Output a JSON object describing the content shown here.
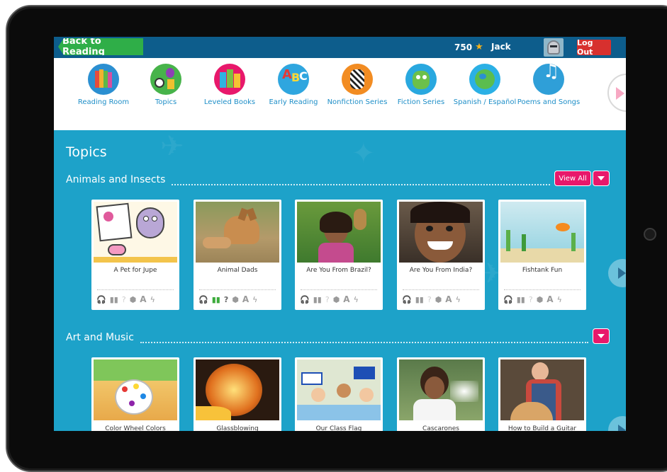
{
  "topbar": {
    "back_label": "Back to Reading",
    "stars": "750",
    "username": "Jack",
    "logout_label": "Log Out"
  },
  "nav": {
    "items": [
      {
        "label": "Reading Room",
        "icon": "books-icon"
      },
      {
        "label": "Topics",
        "icon": "topics-globe-icon"
      },
      {
        "label": "Leveled Books",
        "icon": "leveled-books-icon"
      },
      {
        "label": "Early Reading",
        "icon": "abc-icon"
      },
      {
        "label": "Nonfiction Series",
        "icon": "zebra-icon"
      },
      {
        "label": "Fiction Series",
        "icon": "monster-icon"
      },
      {
        "label": "Spanish / Español",
        "icon": "globe-icon"
      },
      {
        "label": "Poems and Songs",
        "icon": "music-note-icon"
      }
    ]
  },
  "content": {
    "page_title": "Topics",
    "sections": [
      {
        "title": "Animals and Insects",
        "view_all": "View All",
        "books": [
          {
            "title": "A Pet for Jupe"
          },
          {
            "title": "Animal Dads"
          },
          {
            "title": "Are You From Brazil?"
          },
          {
            "title": "Are You From India?"
          },
          {
            "title": "Fishtank Fun"
          }
        ]
      },
      {
        "title": "Art and Music",
        "books": [
          {
            "title": "Color Wheel Colors"
          },
          {
            "title": "Glassblowing"
          },
          {
            "title": "Our Class Flag"
          },
          {
            "title": "Cascarones"
          },
          {
            "title": "How to Build a Guitar"
          }
        ]
      }
    ]
  },
  "colors": {
    "topbar": "#0d5d8c",
    "back_button": "#2fae48",
    "logout": "#d7302e",
    "content_bg": "#1da2c9",
    "accent_pink": "#e8186b",
    "nav_text": "#1f8fc8"
  }
}
